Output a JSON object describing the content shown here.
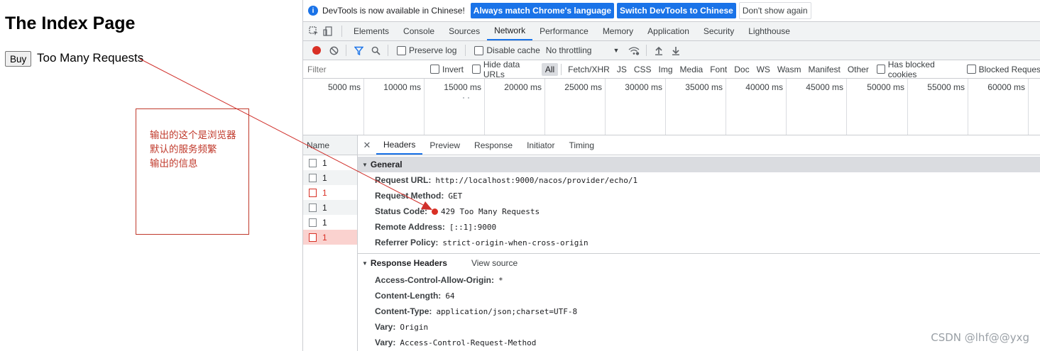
{
  "page": {
    "title": "The Index Page",
    "buy_label": "Buy",
    "message": "Too Many Requests"
  },
  "annotation": {
    "text": "输出的这个是浏览器\n默认的服务频繁\n输出的信息",
    "color": "#c0392b"
  },
  "devtools": {
    "infobar": {
      "text": "DevTools is now available in Chinese!",
      "btn_match": "Always match Chrome's language",
      "btn_switch": "Switch DevTools to Chinese",
      "btn_dismiss": "Don't show again"
    },
    "tabs": [
      "Elements",
      "Console",
      "Sources",
      "Network",
      "Performance",
      "Memory",
      "Application",
      "Security",
      "Lighthouse"
    ],
    "active_tab": "Network",
    "network_toolbar": {
      "preserve_log": "Preserve log",
      "disable_cache": "Disable cache",
      "throttling": "No throttling"
    },
    "filter": {
      "placeholder": "Filter",
      "invert": "Invert",
      "hide_data_urls": "Hide data URLs",
      "types": [
        "All",
        "Fetch/XHR",
        "JS",
        "CSS",
        "Img",
        "Media",
        "Font",
        "Doc",
        "WS",
        "Wasm",
        "Manifest",
        "Other"
      ],
      "has_blocked_cookies": "Has blocked cookies",
      "blocked_requests": "Blocked Reques"
    },
    "timeline_ticks": [
      "5000 ms",
      "10000 ms",
      "15000 ms",
      "20000 ms",
      "25000 ms",
      "30000 ms",
      "35000 ms",
      "40000 ms",
      "45000 ms",
      "50000 ms",
      "55000 ms",
      "60000 ms"
    ],
    "requests": {
      "header": "Name",
      "rows": [
        {
          "name": "1",
          "state": "normal"
        },
        {
          "name": "1",
          "state": "normal"
        },
        {
          "name": "1",
          "state": "error"
        },
        {
          "name": "1",
          "state": "normal"
        },
        {
          "name": "1",
          "state": "normal"
        },
        {
          "name": "1",
          "state": "selected"
        }
      ]
    },
    "detail": {
      "tabs": [
        "Headers",
        "Preview",
        "Response",
        "Initiator",
        "Timing"
      ],
      "active_tab": "Headers",
      "general": {
        "title": "General",
        "request_url_key": "Request URL:",
        "request_url": "http://localhost:9000/nacos/provider/echo/1",
        "request_method_key": "Request Method:",
        "request_method": "GET",
        "status_code_key": "Status Code:",
        "status_code": "429 Too Many Requests",
        "remote_address_key": "Remote Address:",
        "remote_address": "[::1]:9000",
        "referrer_policy_key": "Referrer Policy:",
        "referrer_policy": "strict-origin-when-cross-origin"
      },
      "response_headers": {
        "title": "Response Headers",
        "view_source": "View source",
        "items": [
          {
            "key": "Access-Control-Allow-Origin:",
            "value": "*"
          },
          {
            "key": "Content-Length:",
            "value": "64"
          },
          {
            "key": "Content-Type:",
            "value": "application/json;charset=UTF-8"
          },
          {
            "key": "Vary:",
            "value": "Origin"
          },
          {
            "key": "Vary:",
            "value": "Access-Control-Request-Method"
          }
        ]
      }
    }
  },
  "watermark": "CSDN @lhf@@yxg"
}
